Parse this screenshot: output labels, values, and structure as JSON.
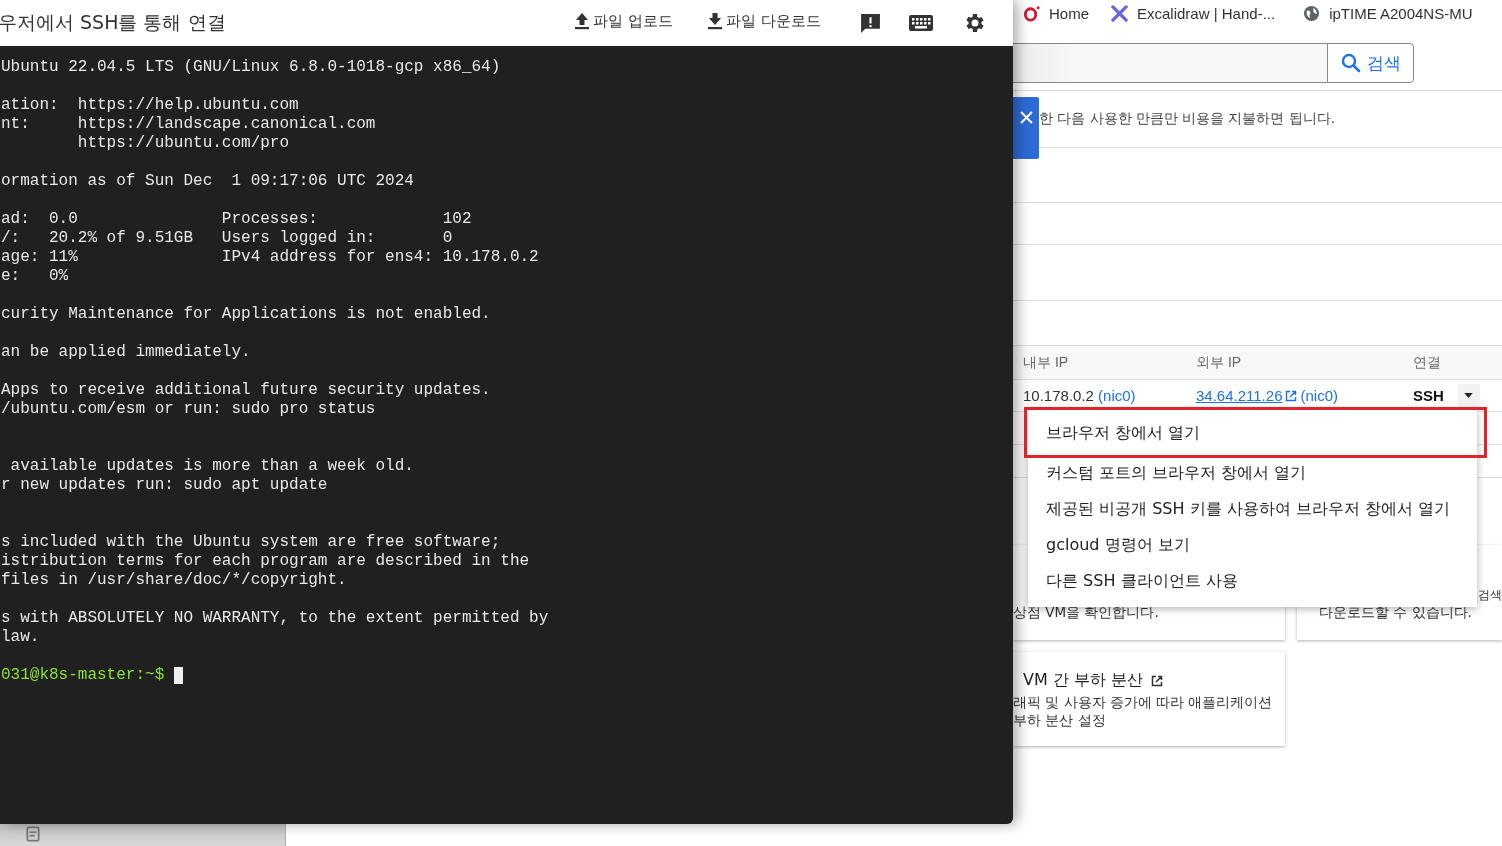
{
  "ssh_window": {
    "title": "우저에서 SSH를 통해 연결",
    "actions": [
      {
        "label": "파일 업로드",
        "kind": "upload"
      },
      {
        "label": "파일 다운로드",
        "kind": "download"
      }
    ],
    "icon_buttons": [
      {
        "kind": "feedback"
      },
      {
        "kind": "keyboard"
      },
      {
        "kind": "settings"
      }
    ],
    "terminal": {
      "lines": [
        {
          "kind": "text",
          "text": "Ubuntu 22.04.5 LTS (GNU/Linux 6.8.0-1018-gcp x86_64)"
        },
        {
          "kind": "blank"
        },
        {
          "kind": "text",
          "text": "ation:  https://help.ubuntu.com"
        },
        {
          "kind": "text",
          "text": "nt:     https://landscape.canonical.com"
        },
        {
          "kind": "text",
          "text": "        https://ubuntu.com/pro"
        },
        {
          "kind": "blank"
        },
        {
          "kind": "text",
          "text": "ormation as of Sun Dec  1 09:17:06 UTC 2024"
        },
        {
          "kind": "blank"
        },
        {
          "kind": "text",
          "text": "ad:  0.0               Processes:             102"
        },
        {
          "kind": "text",
          "text": "/:   20.2% of 9.51GB   Users logged in:       0"
        },
        {
          "kind": "text",
          "text": "age: 11%               IPv4 address for ens4: 10.178.0.2"
        },
        {
          "kind": "text",
          "text": "e:   0%"
        },
        {
          "kind": "blank"
        },
        {
          "kind": "text",
          "text": "curity Maintenance for Applications is not enabled."
        },
        {
          "kind": "blank"
        },
        {
          "kind": "text",
          "text": "an be applied immediately."
        },
        {
          "kind": "blank"
        },
        {
          "kind": "text",
          "text": "Apps to receive additional future security updates."
        },
        {
          "kind": "text",
          "text": "/ubuntu.com/esm or run: sudo pro status"
        },
        {
          "kind": "blank"
        },
        {
          "kind": "blank"
        },
        {
          "kind": "text",
          "text": " available updates is more than a week old."
        },
        {
          "kind": "text",
          "text": "r new updates run: sudo apt update"
        },
        {
          "kind": "blank"
        },
        {
          "kind": "blank"
        },
        {
          "kind": "text",
          "text": "s included with the Ubuntu system are free software;"
        },
        {
          "kind": "text",
          "text": "istribution terms for each program are described in the"
        },
        {
          "kind": "text",
          "text": "files in /usr/share/doc/*/copyright."
        },
        {
          "kind": "blank"
        },
        {
          "kind": "text",
          "text": "s with ABSOLUTELY NO WARRANTY, to the extent permitted by"
        },
        {
          "kind": "text",
          "text": "law."
        },
        {
          "kind": "blank"
        },
        {
          "kind": "prompt",
          "text": "031@k8s-master:~$"
        }
      ]
    }
  },
  "bookmarks": [
    {
      "label": "Home",
      "kind": "opera"
    },
    {
      "label": "Excalidraw | Hand-...",
      "kind": "excalidraw"
    },
    {
      "label": "ipTIME A2004NS-MU",
      "kind": "globe"
    }
  ],
  "search": {
    "button": "검색"
  },
  "notice": {
    "text": "한 다음 사용한 만큼만 비용을 지불하면 됩니다."
  },
  "table": {
    "columns": [
      "내부 IP",
      "외부 IP",
      "연결"
    ],
    "rows": [
      {
        "internal_ip": "10.178.0.2",
        "internal_nic": "(nic0)",
        "external_ip": "34.64.211.26",
        "external_nic": "(nic0)",
        "connect": "SSH"
      }
    ]
  },
  "connect_menu": {
    "items": [
      {
        "label": "브라우저 창에서 열기",
        "highlighted": true
      },
      {
        "label": "커스텀 포트의 브라우저 창에서 열기",
        "highlighted": false
      },
      {
        "label": "제공된 비공개 SSH 키를 사용하여 브라우저 창에서 열기",
        "highlighted": false
      },
      {
        "label": "gcloud 명령어 보기",
        "highlighted": false
      },
      {
        "label": "다른 SSH 클라이언트 사용",
        "highlighted": false
      }
    ]
  },
  "cards": [
    {
      "kind": "left",
      "lines": [
        "상점 VM을 확인합니다."
      ]
    },
    {
      "kind": "right",
      "corner": "검색",
      "lines": [
        "다운로드할 수 있습니다."
      ]
    },
    {
      "kind": "left",
      "title": "VM 간 부하 분산",
      "external": true,
      "lines": [
        "래픽 및 사용자 증가에 따라 애플리케이션",
        "부하 분산 설정"
      ]
    }
  ]
}
